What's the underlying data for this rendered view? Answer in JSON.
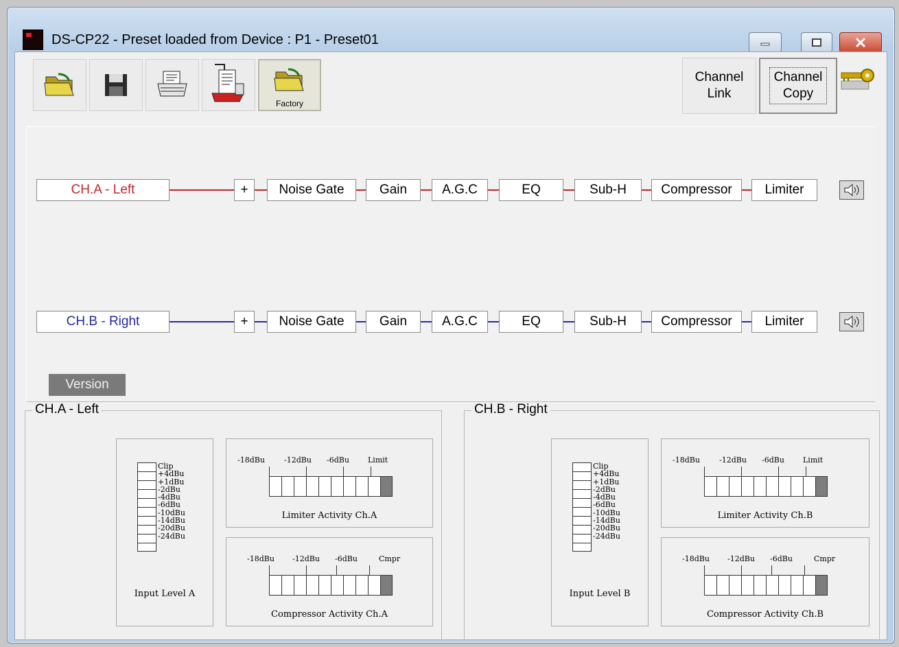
{
  "window": {
    "title": "DS-CP22 - Preset loaded from Device : P1 - Preset01",
    "controls": {
      "minimize": "minimize-icon",
      "maximize": "maximize-icon",
      "close": "close-icon"
    }
  },
  "toolbar": {
    "buttons": [
      {
        "icon": "open-folder-icon"
      },
      {
        "icon": "save-disk-icon"
      },
      {
        "icon": "print-icon"
      },
      {
        "icon": "print-report-icon"
      },
      {
        "icon": "factory-folder-icon",
        "label": "Factory"
      }
    ],
    "channel_link": {
      "line1": "Channel",
      "line2": "Link"
    },
    "channel_copy": {
      "line1": "Channel",
      "line2": "Copy"
    },
    "key_icon": "key-icon"
  },
  "chains": {
    "a": {
      "name": "CH.A - Left",
      "blocks": [
        "+",
        "Noise Gate",
        "Gain",
        "A.G.C",
        "EQ",
        "Sub-H",
        "Compressor",
        "Limiter"
      ],
      "color": "#c0282a"
    },
    "b": {
      "name": "CH.B - Right",
      "blocks": [
        "+",
        "Noise Gate",
        "Gain",
        "A.G.C",
        "EQ",
        "Sub-H",
        "Compressor",
        "Limiter"
      ],
      "color": "#262aa0"
    }
  },
  "version_label": "Version",
  "groups": {
    "a": {
      "title": "CH.A - Left",
      "input_label": "Input Level A",
      "limiter_label": "Limiter Activity Ch.A",
      "compressor_label": "Compressor Activity Ch.A"
    },
    "b": {
      "title": "CH.B - Right",
      "input_label": "Input Level B",
      "limiter_label": "Limiter Activity Ch.B",
      "compressor_label": "Compressor Activity Ch.B"
    }
  },
  "input_scale": [
    "Clip",
    "+4dBu",
    "+1dBu",
    "-2dBu",
    "-4dBu",
    "-6dBu",
    "-10dBu",
    "-14dBu",
    "-20dBu",
    "-24dBu"
  ],
  "limiter_scale": [
    "-18dBu",
    "-12dBu",
    "-6dBu",
    "Limit"
  ],
  "compressor_scale": [
    "-18dBu",
    "-12dBu",
    "-6dBu",
    "Cmpr"
  ]
}
